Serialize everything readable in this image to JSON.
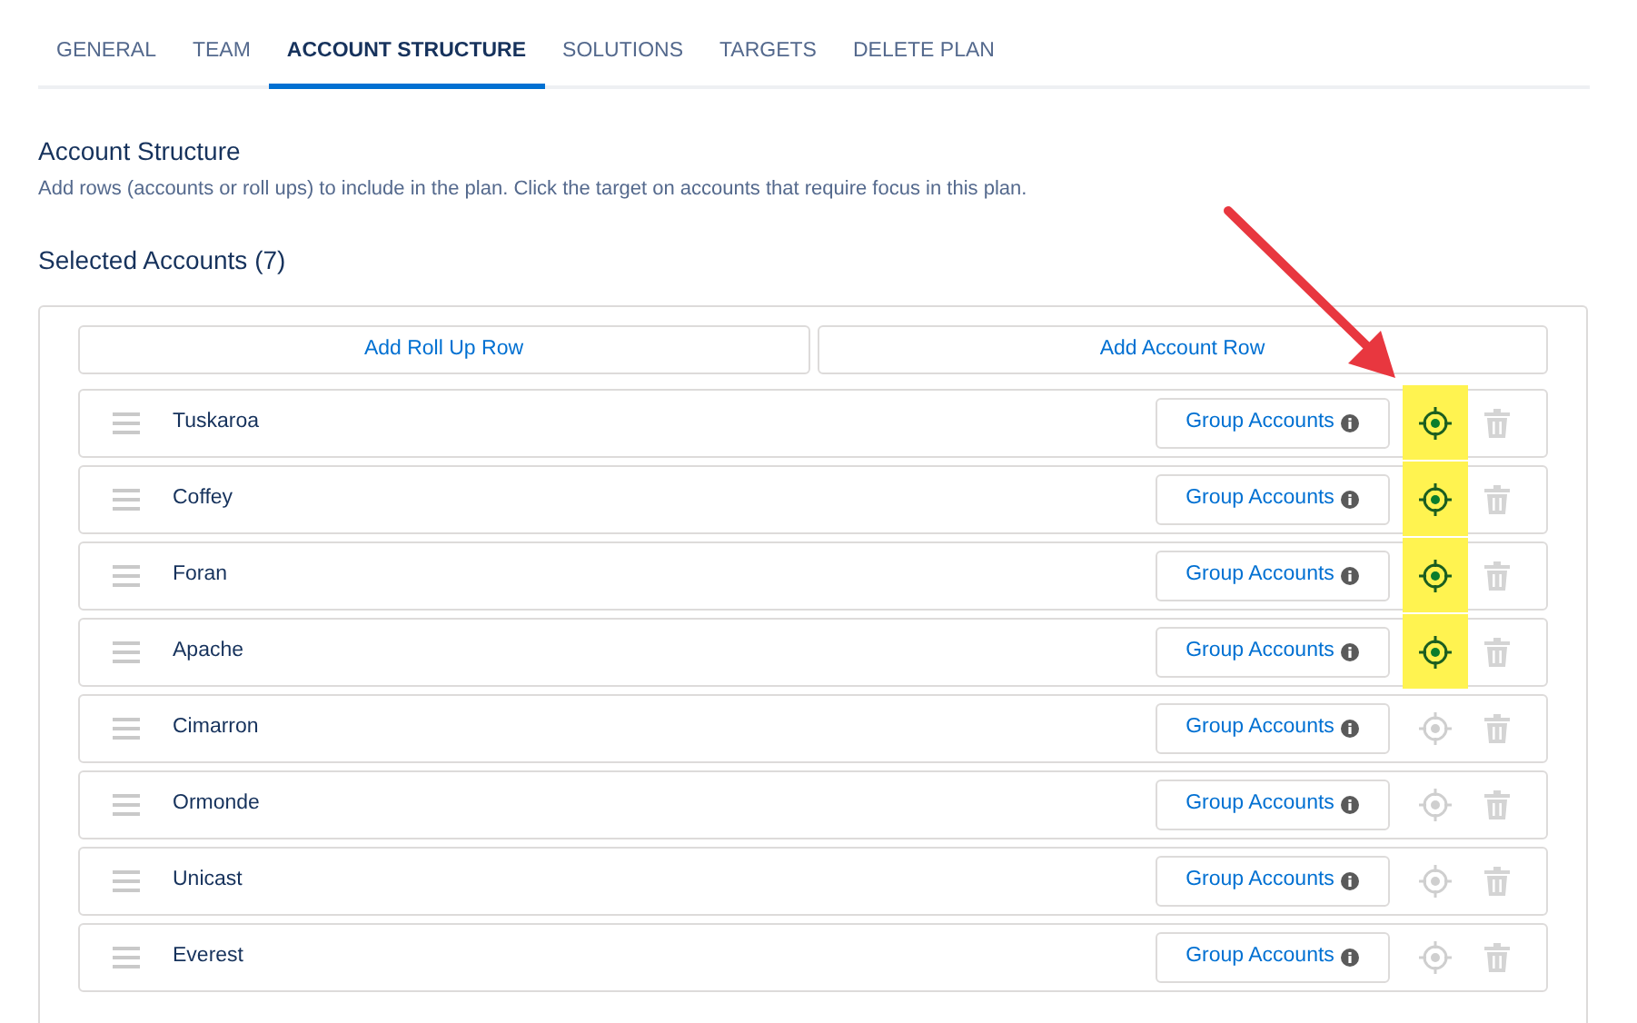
{
  "tabs": [
    {
      "label": "GENERAL",
      "selected": false
    },
    {
      "label": "TEAM",
      "selected": false
    },
    {
      "label": "ACCOUNT STRUCTURE",
      "selected": true
    },
    {
      "label": "SOLUTIONS",
      "selected": false
    },
    {
      "label": "TARGETS",
      "selected": false
    },
    {
      "label": "DELETE PLAN",
      "selected": false
    }
  ],
  "section": {
    "title": "Account Structure",
    "description": "Add rows (accounts or roll ups) to include in the plan. Click the target on accounts that require focus in this plan."
  },
  "selected_accounts": {
    "title": "Selected Accounts (7)",
    "buttons": [
      "Add Roll Up Row",
      "Add Account Row"
    ],
    "rows": [
      {
        "name": "Tuskaroa",
        "group_label": "Group Accounts",
        "focused": true
      },
      {
        "name": "Coffey",
        "group_label": "Group Accounts",
        "focused": true
      },
      {
        "name": "Foran",
        "group_label": "Group Accounts",
        "focused": true
      },
      {
        "name": "Apache",
        "group_label": "Group Accounts",
        "focused": true
      },
      {
        "name": "Cimarron",
        "group_label": "Group Accounts",
        "focused": false
      },
      {
        "name": "Ormonde",
        "group_label": "Group Accounts",
        "focused": false
      },
      {
        "name": "Unicast",
        "group_label": "Group Accounts",
        "focused": false
      },
      {
        "name": "Everest",
        "group_label": "Group Accounts",
        "focused": false
      }
    ]
  },
  "annotation": {
    "kind": "arrow"
  }
}
